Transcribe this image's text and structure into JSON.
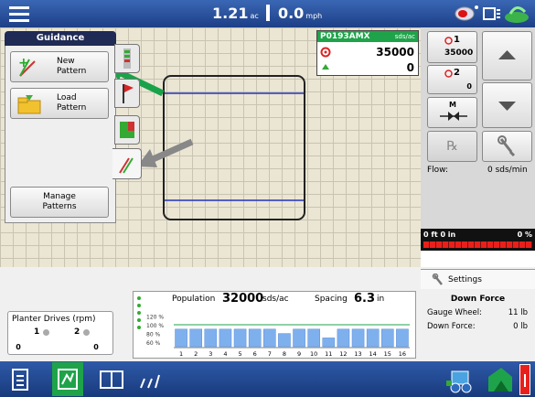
{
  "topbar": {
    "area_value": "1.21",
    "area_unit": "ac",
    "speed_value": "0.0",
    "speed_unit": "mph"
  },
  "guidance": {
    "title": "Guidance",
    "new_pattern": "New\nPattern",
    "load_pattern": "Load\nPattern",
    "manage_patterns": "Manage\nPatterns"
  },
  "product": {
    "name": "P0193AMX",
    "unit": "sds/ac",
    "target_rate": "35000",
    "secondary": "0"
  },
  "rates": {
    "r1_label": "1",
    "r1_value": "35000",
    "r2_label": "2",
    "r2_value": "0"
  },
  "controls": {
    "manual_label": "M",
    "flow_label": "Flow:",
    "flow_value": "0 sds/min"
  },
  "status_strip": {
    "left": "0 ft 0 in",
    "right": "0 %"
  },
  "planter_drives": {
    "title": "Planter Drives (rpm)",
    "d1_label": "1",
    "d1_value": "0",
    "d2_label": "2",
    "d2_value": "0"
  },
  "population_chart": {
    "population_label": "Population",
    "population_value": "32000",
    "population_unit": "sds/ac",
    "spacing_label": "Spacing",
    "spacing_value": "6.3",
    "spacing_unit": "in",
    "pct_labels": [
      "120 %",
      "100 %",
      "80 %",
      "60 %"
    ]
  },
  "chart_data": {
    "type": "bar",
    "categories": [
      "1",
      "2",
      "3",
      "4",
      "5",
      "6",
      "7",
      "8",
      "9",
      "10",
      "11",
      "12",
      "13",
      "14",
      "15",
      "16"
    ],
    "values": [
      90,
      90,
      90,
      90,
      90,
      90,
      90,
      80,
      90,
      90,
      70,
      90,
      90,
      90,
      90,
      90
    ],
    "ylim": [
      50,
      125
    ],
    "reference_line": 100
  },
  "settings": {
    "label": "Settings",
    "title": "Down Force",
    "gauge_wheel_label": "Gauge Wheel:",
    "gauge_wheel_value": "11 lb",
    "down_force_label": "Down Force:",
    "down_force_value": "0 lb"
  },
  "colors": {
    "topbar": "#1d3f86",
    "accent_green": "#1fa34a",
    "arrow_green": "#1aa24a",
    "bar_blue": "#7fb0ee",
    "red": "#e8201c"
  }
}
